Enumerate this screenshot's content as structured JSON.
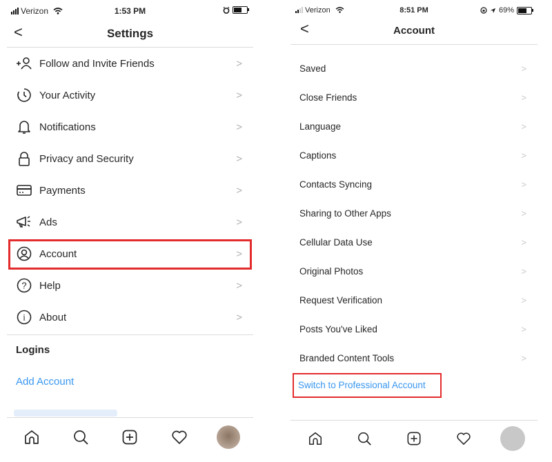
{
  "left": {
    "status": {
      "carrier": "Verizon",
      "time": "1:53 PM"
    },
    "nav": {
      "back": "<",
      "title": "Settings"
    },
    "items": [
      {
        "label": "Follow and Invite Friends",
        "icon": "add-person-icon"
      },
      {
        "label": "Your Activity",
        "icon": "activity-clock-icon"
      },
      {
        "label": "Notifications",
        "icon": "bell-icon"
      },
      {
        "label": "Privacy and Security",
        "icon": "lock-icon"
      },
      {
        "label": "Payments",
        "icon": "credit-card-icon"
      },
      {
        "label": "Ads",
        "icon": "megaphone-icon"
      },
      {
        "label": "Account",
        "icon": "account-circle-icon"
      },
      {
        "label": "Help",
        "icon": "help-circle-icon"
      },
      {
        "label": "About",
        "icon": "info-circle-icon"
      }
    ],
    "chevron": ">",
    "logins": {
      "heading": "Logins",
      "add_account": "Add Account"
    }
  },
  "right": {
    "status": {
      "carrier": "Verizon",
      "time": "8:51 PM",
      "battery": "69%",
      "battery_level": 0.69
    },
    "nav": {
      "back": "<",
      "title": "Account"
    },
    "items": [
      "Saved",
      "Close Friends",
      "Language",
      "Captions",
      "Contacts Syncing",
      "Sharing to Other Apps",
      "Cellular Data Use",
      "Original Photos",
      "Request Verification",
      "Posts You've Liked",
      "Branded Content Tools"
    ],
    "chevron": ">",
    "switch_link": "Switch to Professional Account"
  },
  "tabbar": [
    "home-icon",
    "search-icon",
    "new-post-icon",
    "activity-heart-icon",
    "profile-avatar"
  ],
  "colors": {
    "highlight": "#e32b2b",
    "link": "#3897f0",
    "divider": "#dbdbdb"
  }
}
